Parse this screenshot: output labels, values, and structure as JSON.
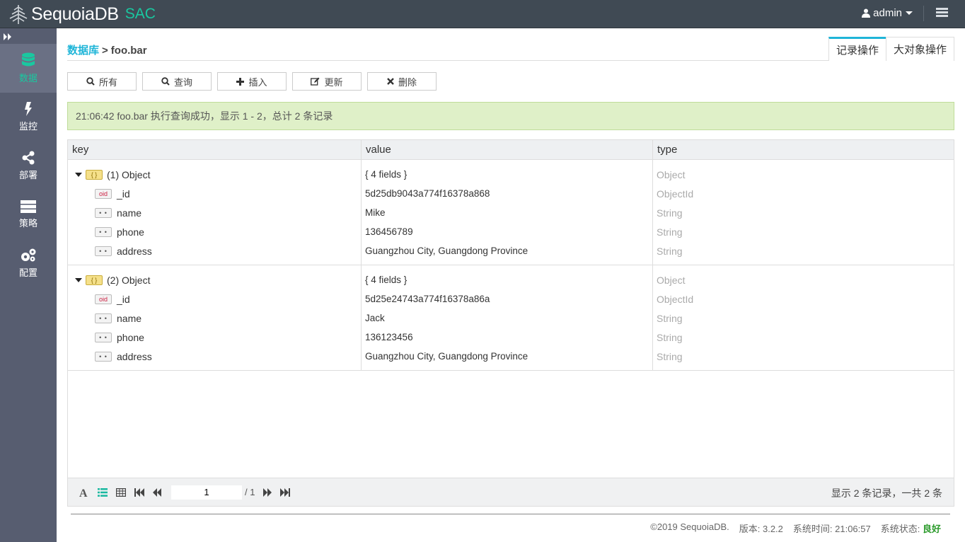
{
  "header": {
    "brand": "SequoiaDB",
    "product": "SAC",
    "user": "admin"
  },
  "sidebar": {
    "items": [
      {
        "label": "数据",
        "icon": "database-icon",
        "active": true
      },
      {
        "label": "监控",
        "icon": "lightning-icon"
      },
      {
        "label": "部署",
        "icon": "share-icon"
      },
      {
        "label": "策略",
        "icon": "server-icon"
      },
      {
        "label": "配置",
        "icon": "gears-icon"
      }
    ]
  },
  "breadcrumb": {
    "root": "数据库",
    "sep": ">",
    "current": "foo.bar"
  },
  "tabs": [
    "记录操作",
    "大对象操作"
  ],
  "toolbar": {
    "all": "所有",
    "query": "查询",
    "insert": "插入",
    "update": "更新",
    "delete": "删除"
  },
  "alert": "21:06:42 foo.bar 执行查询成功，显示 1 - 2，总计 2 条记录",
  "grid": {
    "columns": [
      "key",
      "value",
      "type"
    ],
    "records": [
      {
        "title": "(1) Object",
        "value": "{ 4 fields }",
        "type": "Object",
        "fields": [
          {
            "badge": "oid",
            "key": "_id",
            "value": "5d25db9043a774f16378a868",
            "type": "ObjectId"
          },
          {
            "badge": "str",
            "key": "name",
            "value": "Mike",
            "type": "String"
          },
          {
            "badge": "str",
            "key": "phone",
            "value": "136456789",
            "type": "String"
          },
          {
            "badge": "str",
            "key": "address",
            "value": "Guangzhou City, Guangdong Province",
            "type": "String"
          }
        ]
      },
      {
        "title": "(2) Object",
        "value": "{ 4 fields }",
        "type": "Object",
        "fields": [
          {
            "badge": "oid",
            "key": "_id",
            "value": "5d25e24743a774f16378a86a",
            "type": "ObjectId"
          },
          {
            "badge": "str",
            "key": "name",
            "value": "Jack",
            "type": "String"
          },
          {
            "badge": "str",
            "key": "phone",
            "value": "136123456",
            "type": "String"
          },
          {
            "badge": "str",
            "key": "address",
            "value": "Guangzhou City, Guangdong Province",
            "type": "String"
          }
        ]
      }
    ],
    "badge_labels": {
      "object": "{ }",
      "oid": "oid",
      "str": "• •"
    },
    "page": "1",
    "total_pages": "/ 1",
    "summary": "显示 2 条记录，一共 2 条"
  },
  "footer": {
    "copyright": "©2019 SequoiaDB.",
    "version": "版本: 3.2.2",
    "time": "系统时间: 21:06:57",
    "status_label": "系统状态:",
    "status_value": "良好"
  },
  "colors": {
    "accent": "#1fb5d8",
    "brand_green": "#19c8a0",
    "topbar": "#404a54",
    "sidebar": "#575d70",
    "alert_bg": "#dff0c8"
  }
}
